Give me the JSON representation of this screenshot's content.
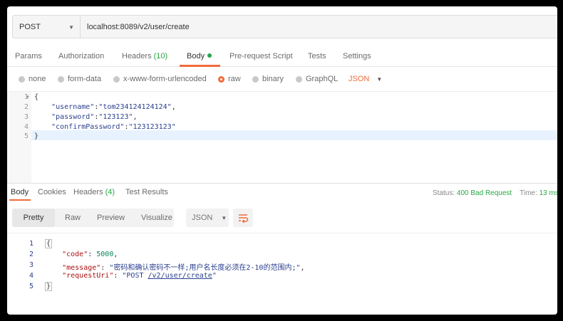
{
  "request": {
    "method": "POST",
    "url": "localhost:8089/v2/user/create"
  },
  "request_tabs": {
    "params": "Params",
    "authorization": "Authorization",
    "headers": "Headers",
    "headers_count": "(10)",
    "body": "Body",
    "prerequest": "Pre-request Script",
    "tests": "Tests",
    "settings": "Settings"
  },
  "body_types": {
    "none": "none",
    "form_data": "form-data",
    "urlencoded": "x-www-form-urlencoded",
    "raw": "raw",
    "binary": "binary",
    "graphql": "GraphQL",
    "format": "JSON",
    "selected": "raw"
  },
  "request_body": {
    "line_numbers": [
      "1",
      "2",
      "3",
      "4",
      "5"
    ],
    "open": "{",
    "username_key": "\"username\"",
    "username_val": "\"tom234124124124\"",
    "password_key": "\"password\"",
    "password_val": "\"123123\"",
    "confirm_key": "\"confirmPassword\"",
    "confirm_val": "\"123123123\"",
    "close": "}"
  },
  "response_tabs": {
    "body": "Body",
    "cookies": "Cookies",
    "headers": "Headers",
    "headers_count": "(4)",
    "test_results": "Test Results",
    "status_label": "Status:",
    "status_value": "400 Bad Request",
    "time_label": "Time:",
    "time_value": "13 ms"
  },
  "view": {
    "pretty": "Pretty",
    "raw": "Raw",
    "preview": "Preview",
    "visualize": "Visualize",
    "format": "JSON",
    "wrap_icon": "wrap-lines-icon"
  },
  "response_body": {
    "line_numbers": [
      "1",
      "2",
      "3",
      "4",
      "5"
    ],
    "open": "{",
    "code_key": "\"code\"",
    "code_val": "5000",
    "message_key": "\"message\"",
    "message_val": "\"密码和确认密码不一样;用户名长度必须在2-10的范围内;\"",
    "uri_key": "\"requestUri\"",
    "uri_val_prefix": "\"POST ",
    "uri_val_link": "/v2/user/create",
    "uri_val_suffix": "\"",
    "close": "}"
  },
  "colors": {
    "accent": "#f26b3a",
    "status_ok_green": "#28a745"
  }
}
